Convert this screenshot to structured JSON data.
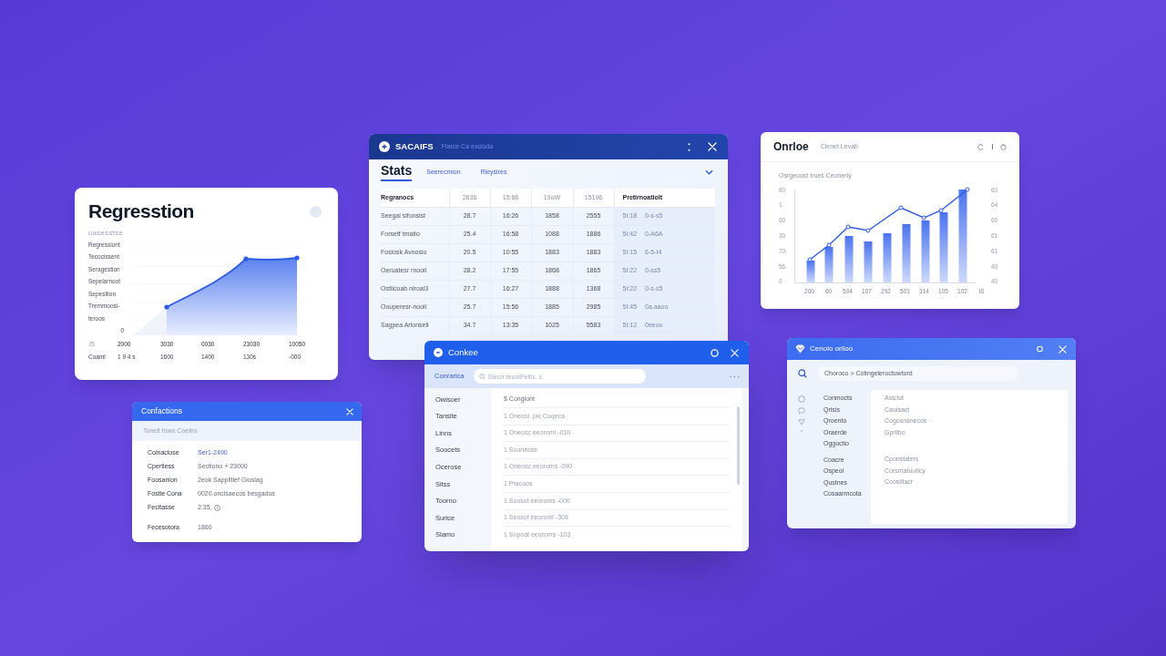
{
  "regression_card": {
    "title": "Regresstion",
    "caption": "uasesstse",
    "y_labels": [
      "Regressiont",
      "Tecocissent",
      "Seragestion",
      "Sepelarnoot",
      "Sepesilion",
      "Tremmoosi-",
      "teroos",
      "0"
    ],
    "x_labels": [
      "J5",
      "2000",
      "3030",
      "0030",
      "23030",
      "10050"
    ],
    "count_row": [
      "Coaml",
      "1 9 4 s",
      "1600",
      "1400",
      "130s",
      "-000"
    ]
  },
  "stats_window": {
    "title": "SACAIFS",
    "subtitle": "Flarce Ca excloda",
    "tabs": [
      {
        "label": "Stats",
        "selected": true
      },
      {
        "label": "Seerecmion",
        "selected": false
      },
      {
        "label": "Rleysires",
        "selected": false
      }
    ],
    "table": {
      "columns": [
        {
          "label": "Regranocs"
        },
        {
          "label": "2636"
        },
        {
          "label": "15:66"
        },
        {
          "label": "19oW"
        },
        {
          "label": "15196"
        },
        {
          "label": "Pretirnoatiolt",
          "colspan": 2
        }
      ],
      "rows": [
        [
          "Seegal sifonsist",
          "28.7",
          "16:26",
          "1858",
          "2555",
          "5I:18",
          "0-s-s5"
        ],
        [
          "Forsetf tmatio",
          "25.4",
          "16:58",
          "1088",
          "1886",
          "5I:42",
          "0-A6A"
        ],
        [
          "Fosiosk Avnosio",
          "20.5",
          "10:55",
          "1883",
          "1883",
          "5I:15",
          "6-5-t4"
        ],
        [
          "Oeruatesr rnooil",
          "28.2",
          "17:55",
          "1868",
          "1865",
          "5I:22",
          "0-ss5"
        ],
        [
          "Ostlicoab nlroai3",
          "27.7",
          "16:27",
          "1888",
          "1368",
          "5I:22",
          "0-s-s5"
        ],
        [
          "Oouperesr-nooli",
          "25.7",
          "15:56",
          "1885",
          "2985",
          "5I:45",
          "0a.aaoo"
        ],
        [
          "Sagpea Arlonsell",
          "34.7",
          "13:35",
          "1025",
          "5583",
          "5I:12",
          "0eeoo"
        ]
      ]
    }
  },
  "online_card": {
    "title": "Onrloe",
    "subtitle": "Clenet Levab",
    "chart_caption": "Osrgeoost trues Ceonerly",
    "left_ticks": [
      "80",
      "1",
      "60",
      "30",
      "70",
      "56",
      "0"
    ],
    "right_ticks": [
      "60",
      "64",
      "60",
      "61",
      "61",
      "40",
      "40"
    ],
    "x_labels": [
      "200",
      "60",
      "504",
      "107",
      "292",
      "501",
      "314",
      "105",
      "102",
      "IS"
    ]
  },
  "confections_card": {
    "title": "Confactions",
    "subtitle": "Toneit fowo Coeliro",
    "rows": [
      {
        "label": "Colnaclose",
        "value": "Ser1-2490",
        "kind": "link"
      },
      {
        "label": "Cpertless",
        "value": "Sectiono + 23000",
        "kind": "text"
      },
      {
        "label": "Foosanion",
        "value": "2eok Sappiltief Gioslag",
        "kind": "text"
      },
      {
        "label": "Fostle Cona",
        "value": "0020.oncisaecos besgados",
        "kind": "text"
      },
      {
        "label": "Fecitasse",
        "value": "2:35,",
        "kind": "time"
      },
      {
        "label": "Fecesotora",
        "value": "1860",
        "kind": "text"
      }
    ]
  },
  "conkee_window": {
    "title": "Conkee",
    "toolbar_label": "Conrarica",
    "search": {
      "placeholder": "Siecrr teunlPeilis. z."
    },
    "sidebar": {
      "items": [
        "Owisoer",
        "Tansite",
        "Linns",
        "Soocets",
        "Ocerose",
        "Sitss",
        "Toorno",
        "Surice",
        "Slamo"
      ]
    },
    "list": {
      "header": "$ Conglont",
      "rows": [
        "1 Oneosl .pw Coqeca",
        "1 Oneosc eeoroml -010",
        "1 Soonitose",
        "1 Oneosc eeoroms -090",
        "1 Pracoos",
        "1 Soosot eeoroms -000",
        "1 Seosot eeoroml -308",
        "1 Sopoat eeoroms -103"
      ]
    }
  },
  "console_window": {
    "title": "Cenoio orlloo",
    "breadcrumb": "Choroco > Cotingeleroctuwtord",
    "left_groups": [
      [
        "Conmocts",
        "Qrisis",
        "Qroento",
        "Oraerde",
        "Oggoctio"
      ],
      [
        "Coacre",
        "Ospeol",
        "Qustnes",
        "Cosaarmcota"
      ]
    ],
    "right_groups": [
      [
        "Astclot",
        "Caoisact",
        "Cogosnsnecos",
        "Gpriibo"
      ],
      [
        "Cponstalers",
        "Corsmatuuticy",
        "Coosiltacr"
      ]
    ]
  }
}
